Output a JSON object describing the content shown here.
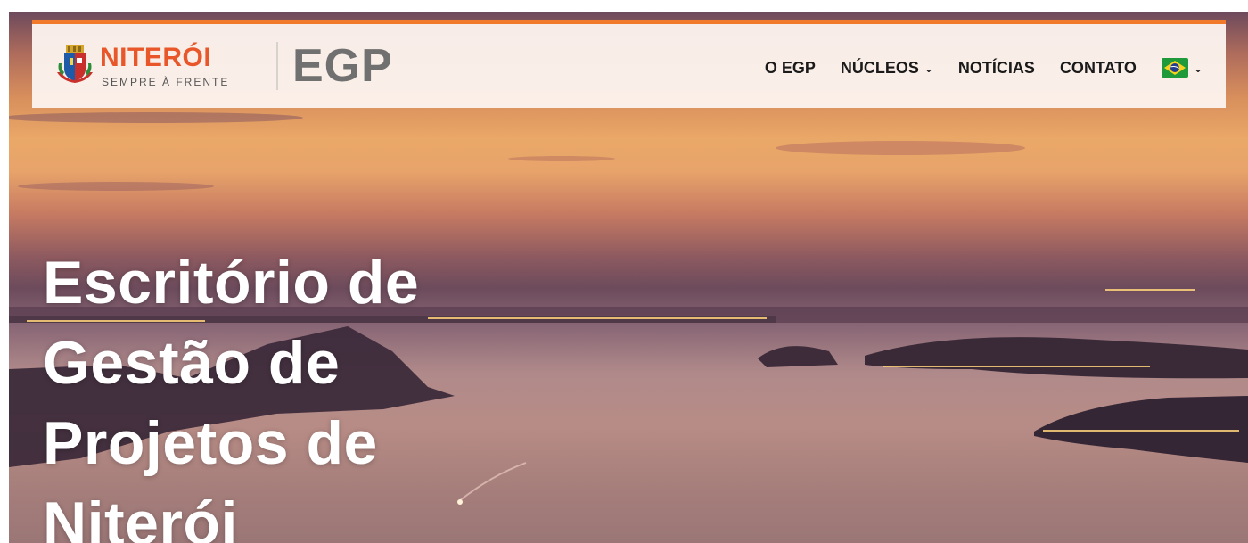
{
  "header": {
    "city_name": "NITERÓI",
    "city_slogan": "SEMPRE À FRENTE",
    "egp_logo": "EGP",
    "accent_color": "#f07a2a"
  },
  "nav": {
    "items": [
      {
        "label": "O EGP",
        "has_dropdown": false
      },
      {
        "label": "NÚCLEOS",
        "has_dropdown": true
      },
      {
        "label": "NOTÍCIAS",
        "has_dropdown": false
      },
      {
        "label": "CONTATO",
        "has_dropdown": false
      }
    ],
    "language_flag": "brazil-flag-icon",
    "chevron": "⌄"
  },
  "hero": {
    "title_lines": [
      "Escritório de",
      "Gestão de",
      "Projetos de",
      "Niterói"
    ]
  }
}
